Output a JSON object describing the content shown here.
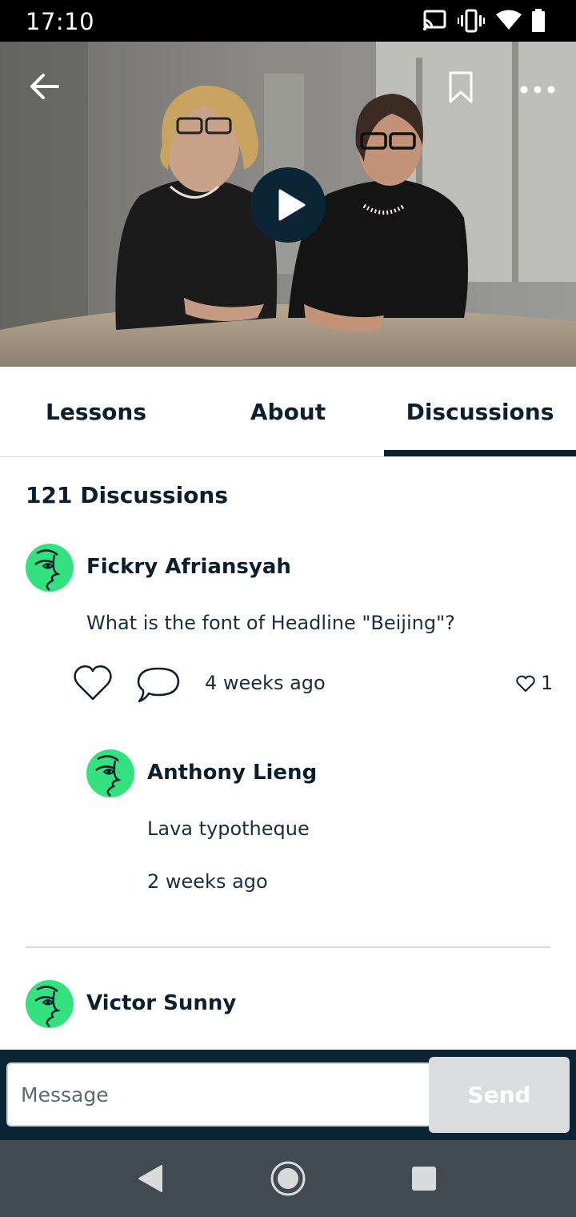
{
  "status_bar": {
    "time": "17:10",
    "icons": [
      "cast-icon",
      "vibrate-icon",
      "wifi-icon",
      "battery-icon"
    ]
  },
  "video": {
    "controls": [
      "back-arrow-icon",
      "bookmark-icon",
      "more-options-icon",
      "play-icon"
    ]
  },
  "tabs": [
    {
      "label": "Lessons",
      "active": false
    },
    {
      "label": "About",
      "active": false
    },
    {
      "label": "Discussions",
      "active": true
    }
  ],
  "discussions": {
    "count_title": "121 Discussions",
    "threads": [
      {
        "author": "Fickry Afriansyah",
        "text": "What is the font of Headline \"Beijing\"?",
        "time": "4 weeks ago",
        "likes": "1",
        "reply": {
          "author": "Anthony Lieng",
          "text": "Lava typotheque",
          "time": "2 weeks ago"
        }
      },
      {
        "author": "Victor Sunny"
      }
    ]
  },
  "composer": {
    "placeholder": "Message",
    "send_label": "Send"
  },
  "nav_bar": {
    "buttons": [
      "nav-back-icon",
      "nav-home-icon",
      "nav-recents-icon"
    ]
  },
  "colors": {
    "primary_dark": "#0b1f2e",
    "avatar_green": "#33e27f",
    "composer_bg": "#0b2536",
    "send_disabled": "#dadcde",
    "nav_bar": "#414a51"
  }
}
